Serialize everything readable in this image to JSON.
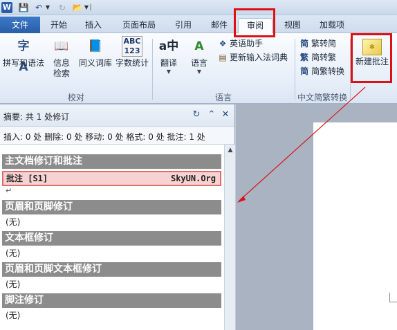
{
  "quick_access": {
    "app_icon": "W",
    "save_icon": "floppy-disk-icon",
    "undo_icon": "undo-icon",
    "redo_icon": "redo-icon",
    "open_icon": "folder-icon"
  },
  "tabs": [
    {
      "label": "文件"
    },
    {
      "label": "开始"
    },
    {
      "label": "插入"
    },
    {
      "label": "页面布局"
    },
    {
      "label": "引用"
    },
    {
      "label": "邮件"
    },
    {
      "label": "审阅",
      "active": true
    },
    {
      "label": "视图"
    },
    {
      "label": "加载项"
    }
  ],
  "ribbon": {
    "proofing": {
      "group_label": "校对",
      "spelling": {
        "label": "拼写和语法",
        "icon_text": "字A"
      },
      "research": {
        "label_line1": "信息",
        "label_line2": "检索"
      },
      "thesaurus": {
        "label": "同义词库"
      },
      "word_count": {
        "label": "字数统计",
        "icon_text": "ABC 123"
      }
    },
    "language": {
      "group_label": "语言",
      "translate": {
        "label": "翻译",
        "icon_text": "a中"
      },
      "language_btn": {
        "label": "语言",
        "icon_text": "A"
      },
      "english_assistant": {
        "label": "英语助手"
      },
      "update_ime": {
        "label": "更新输入法词典"
      }
    },
    "chinese_conversion": {
      "group_label": "中文简繁转换",
      "to_simplified": {
        "label": "繁转简",
        "icon_text": "简"
      },
      "to_traditional": {
        "label": "简转繁",
        "icon_text": "繁"
      },
      "convert": {
        "label": "简繁转换",
        "icon_text": "简"
      }
    },
    "comments": {
      "new_comment": {
        "label": "新建批注"
      }
    }
  },
  "pane": {
    "summary": "摘要: 共 1 处修订",
    "stats": "插入: 0 处 删除: 0 处 移动: 0 处 格式: 0 处 批注: 1 处",
    "sections": {
      "main": {
        "header": "主文档修订和批注"
      },
      "comment": {
        "left": "批注 [S1]",
        "right": "SkyUN.Org"
      },
      "para_mark": "↵",
      "header_footer": {
        "header": "页眉和页脚修订",
        "value": "(无)"
      },
      "textbox": {
        "header": "文本框修订",
        "value": "(无)"
      },
      "hf_textbox": {
        "header": "页眉和页脚文本框修订",
        "value": "(无)"
      },
      "footnote": {
        "header": "脚注修订",
        "value": "(无)"
      }
    }
  },
  "colors": {
    "highlight_red": "#dd1111",
    "file_tab_blue": "#2a5ea8",
    "section_header_gray": "#8c8c8c",
    "comment_pink": "#f7d2d2"
  }
}
